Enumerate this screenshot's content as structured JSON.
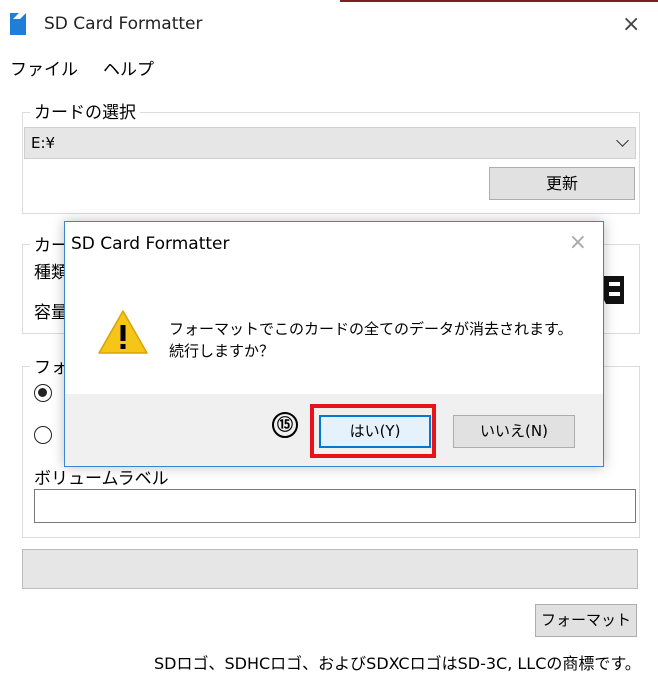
{
  "window": {
    "title": "SD Card Formatter",
    "close_label": "×"
  },
  "menu": {
    "items": [
      "ファイル",
      "ヘルプ"
    ]
  },
  "card_select": {
    "group_title": "カードの選択",
    "drive_value": "E:¥",
    "refresh_label": "更新"
  },
  "card_info": {
    "group_title_partial": "カー",
    "type_label_partial": "種類",
    "capacity_label_partial": "容量"
  },
  "format_options": {
    "group_title_partial": "フォ",
    "volume_label": "ボリュームラベル",
    "volume_value": ""
  },
  "footer": {
    "format_button": "フォーマット",
    "trademark": "SDロゴ、SDHCロゴ、およびSDXCロゴはSD-3C, LLCの商標です。"
  },
  "dialog": {
    "title": "SD Card Formatter",
    "close_label": "×",
    "message_line1": "フォーマットでこのカードの全てのデータが消去されます。",
    "message_line2": "続行しますか？",
    "yes_label": "はい(Y)",
    "no_label": "いいえ(N)"
  },
  "annotation": {
    "step_number": "⑮"
  },
  "colors": {
    "accent": "#3c85d2",
    "highlight": "#e8121b",
    "warning": "#f5c518",
    "brand": "#1f7fd6"
  }
}
